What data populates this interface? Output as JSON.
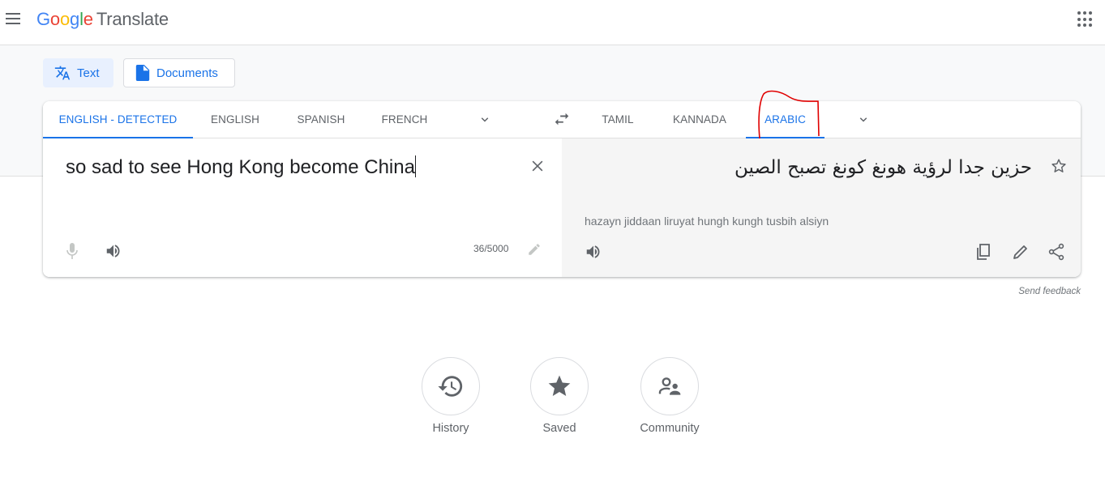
{
  "header": {
    "logo_letters": [
      "G",
      "o",
      "o",
      "g",
      "l",
      "e"
    ],
    "product": "Translate",
    "menu_icon": "hamburger-menu-icon",
    "apps_icon": "apps-grid-icon"
  },
  "modes": [
    {
      "label": "Text",
      "icon": "translate-icon",
      "active": true
    },
    {
      "label": "Documents",
      "icon": "document-icon",
      "active": false
    }
  ],
  "source_languages": [
    {
      "label": "ENGLISH - DETECTED",
      "active": true
    },
    {
      "label": "ENGLISH",
      "active": false
    },
    {
      "label": "SPANISH",
      "active": false
    },
    {
      "label": "FRENCH",
      "active": false
    }
  ],
  "target_languages": [
    {
      "label": "TAMIL",
      "active": false
    },
    {
      "label": "KANNADA",
      "active": false
    },
    {
      "label": "ARABIC",
      "active": true
    }
  ],
  "source": {
    "text": "so sad to see Hong Kong become China",
    "char_count": "36/5000"
  },
  "target": {
    "text": "حزين جدا لرؤية هونغ كونغ تصبح الصين",
    "transliteration": "hazayn jiddaan liruyat hungh kungh tusbih alsiyn"
  },
  "send_feedback": "Send feedback",
  "bottom_actions": [
    {
      "label": "History",
      "icon": "history-icon"
    },
    {
      "label": "Saved",
      "icon": "star-icon"
    },
    {
      "label": "Community",
      "icon": "community-icon"
    }
  ],
  "colors": {
    "accent": "#1a73e8",
    "annotation": "#e00000",
    "target_bg": "#f5f5f5"
  }
}
